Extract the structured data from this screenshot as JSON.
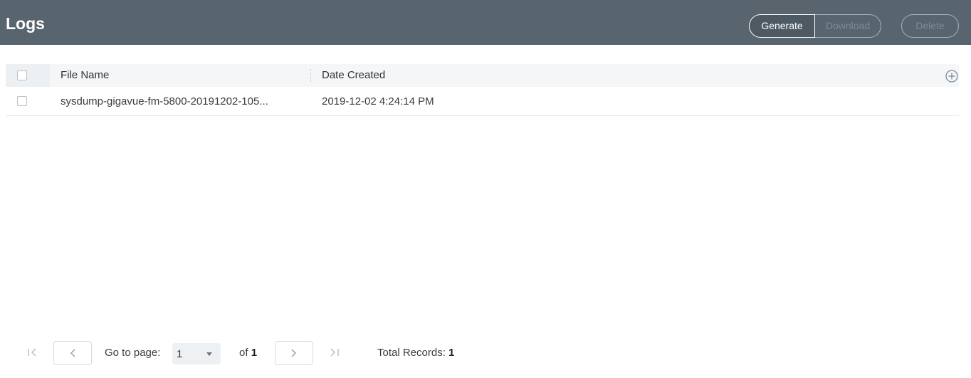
{
  "header": {
    "title": "Logs",
    "buttons": {
      "generate": "Generate",
      "download": "Download",
      "delete": "Delete"
    }
  },
  "table": {
    "columns": [
      "File Name",
      "Date Created"
    ],
    "rows": [
      {
        "file_name": "sysdump-gigavue-fm-5800-20191202-105...",
        "date_created": "2019-12-02 4:24:14 PM"
      }
    ]
  },
  "pagination": {
    "go_to_label": "Go to page:",
    "current_page": "1",
    "of_label": "of",
    "total_pages": "1",
    "total_records_label": "Total Records:",
    "total_records": "1"
  },
  "colors": {
    "header_bg": "#58656f",
    "table_header_bg": "#f4f6f8"
  }
}
